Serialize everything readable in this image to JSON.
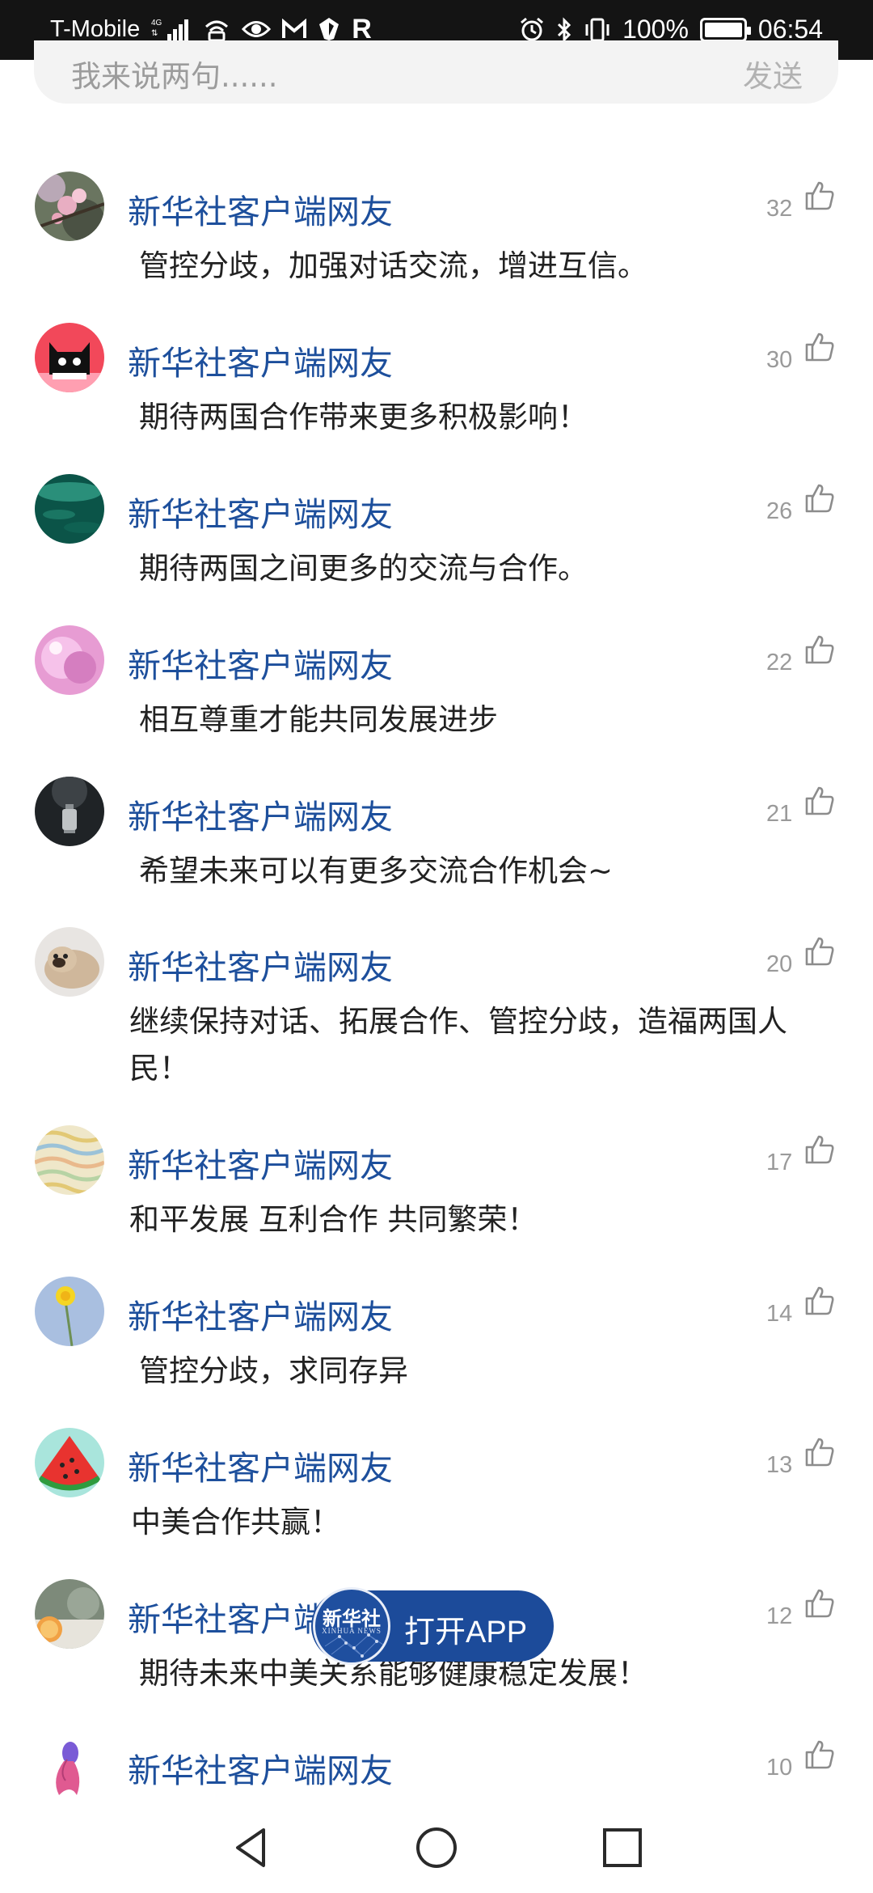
{
  "status_bar": {
    "carrier": "T-Mobile",
    "network": "4G LTE",
    "battery_percent": "100%",
    "battery_level": 1.0,
    "time": "06:54",
    "left_icons": [
      "signal-icon",
      "wifi-calling-icon",
      "eye-icon",
      "gmail-icon",
      "shield-icon",
      "r-icon"
    ],
    "right_icons": [
      "alarm-icon",
      "bluetooth-icon",
      "vibrate-icon",
      "battery-icon"
    ],
    "r_glyph": "R"
  },
  "comment_input": {
    "placeholder": "我来说两句......",
    "send_label": "发送"
  },
  "comments": [
    {
      "user": "新华社客户端网友",
      "likes": "32",
      "text": "管控分歧，加强对话交流，增进互信。",
      "avatar": "peach-blossom"
    },
    {
      "user": "新华社客户端网友",
      "likes": "30",
      "text": "期待两国合作带来更多积极影响！",
      "avatar": "black-cat"
    },
    {
      "user": "新华社客户端网友",
      "likes": "26",
      "text": "期待两国之间更多的交流与合作。",
      "avatar": "green-water"
    },
    {
      "user": "新华社客户端网友",
      "likes": "22",
      "text": "相互尊重才能共同发展进步",
      "avatar": "pink-bubble"
    },
    {
      "user": "新华社客户端网友",
      "likes": "21",
      "text": "希望未来可以有更多交流合作机会~",
      "avatar": "lantern"
    },
    {
      "user": "新华社客户端网友",
      "likes": "20",
      "text": "继续保持对话、拓展合作、管控分歧，造福两国人民！",
      "avatar": "pug"
    },
    {
      "user": "新华社客户端网友",
      "likes": "17",
      "text": "和平发展 互利合作 共同繁荣！",
      "avatar": "waves"
    },
    {
      "user": "新华社客户端网友",
      "likes": "14",
      "text": "管控分歧，求同存异",
      "avatar": "dandelion"
    },
    {
      "user": "新华社客户端网友",
      "likes": "13",
      "text": "中美合作共赢！",
      "avatar": "watermelon"
    },
    {
      "user": "新华社客户端网友",
      "likes": "12",
      "text": "期待未来中美关系能够健康稳定发展！",
      "avatar": "orange-slice"
    },
    {
      "user": "新华社客户端网友",
      "likes": "10",
      "text": "",
      "avatar": "betta-fish"
    }
  ],
  "open_app": {
    "logo_text": "新华社",
    "logo_sub": "XINHUA NEWS",
    "label": "打开APP",
    "color": "#1c4b9a"
  },
  "nav_bar": {
    "icons": [
      "back-icon",
      "home-icon",
      "recents-icon"
    ]
  },
  "colors": {
    "username": "#1d4f9c",
    "count": "#9a9a9a",
    "text": "#222222"
  }
}
